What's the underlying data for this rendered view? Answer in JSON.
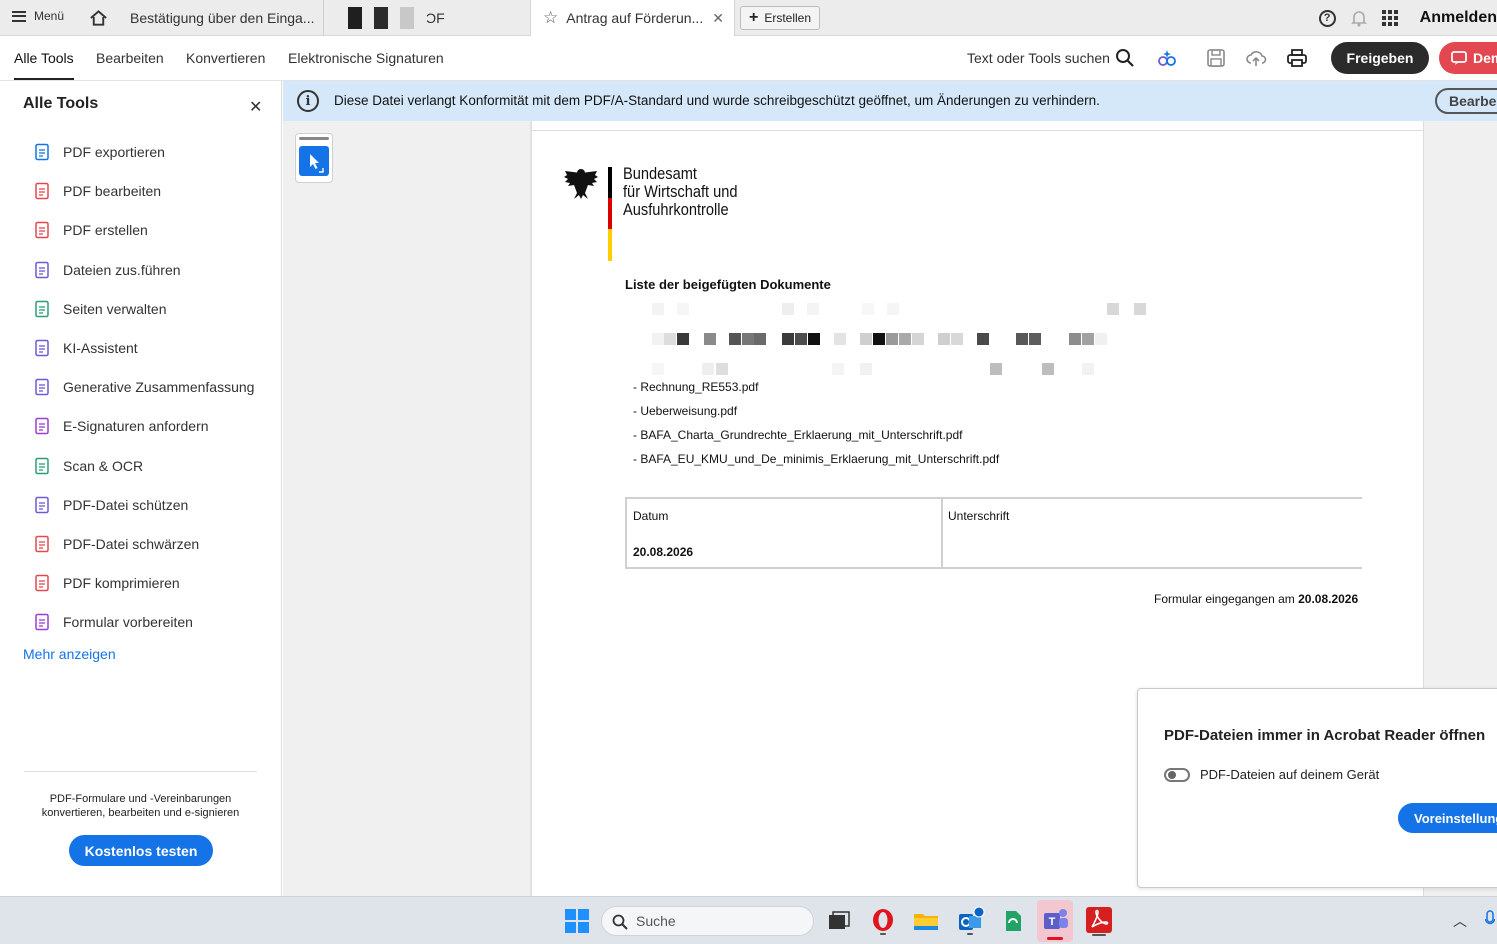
{
  "tabbar": {
    "menu_label": "Menü",
    "tab1_title": "Bestätigung über den Einga...",
    "tab2_suffix": "ϽF",
    "tab3_title": "Antrag auf Förderun...",
    "new_tab_label": "Erstellen",
    "signin_label": "Anmelden"
  },
  "toolbar": {
    "nav": [
      "Alle Tools",
      "Bearbeiten",
      "Konvertieren",
      "Elektronische Signaturen"
    ],
    "search_label": "Text oder Tools suchen",
    "share_label": "Freigeben",
    "demo_label": "Demo"
  },
  "leftpanel": {
    "title": "Alle Tools",
    "items": [
      {
        "label": "PDF exportieren",
        "icon": "export-pdf-icon",
        "color": "#1473e6"
      },
      {
        "label": "PDF bearbeiten",
        "icon": "edit-pdf-icon",
        "color": "#e34850"
      },
      {
        "label": "PDF erstellen",
        "icon": "create-pdf-icon",
        "color": "#e34850"
      },
      {
        "label": "Dateien zus.führen",
        "icon": "combine-files-icon",
        "color": "#6b5bd6"
      },
      {
        "label": "Seiten verwalten",
        "icon": "organize-pages-icon",
        "color": "#2d9d78"
      },
      {
        "label": "KI-Assistent",
        "icon": "ai-assistant-icon",
        "color": "#6b5bd6"
      },
      {
        "label": "Generative Zusammenfassung",
        "icon": "generative-summary-icon",
        "color": "#6b5bd6"
      },
      {
        "label": "E-Signaturen anfordern",
        "icon": "request-esign-icon",
        "color": "#9b3ed6"
      },
      {
        "label": "Scan & OCR",
        "icon": "scan-ocr-icon",
        "color": "#2d9d78"
      },
      {
        "label": "PDF-Datei schützen",
        "icon": "protect-pdf-icon",
        "color": "#6b5bd6"
      },
      {
        "label": "PDF-Datei schwärzen",
        "icon": "redact-pdf-icon",
        "color": "#e34850"
      },
      {
        "label": "PDF komprimieren",
        "icon": "compress-pdf-icon",
        "color": "#e34850"
      },
      {
        "label": "Formular vorbereiten",
        "icon": "prepare-form-icon",
        "color": "#9b3ed6"
      }
    ],
    "more_label": "Mehr anzeigen",
    "promo_text": "PDF-Formulare und -Vereinbarungen konvertieren, bearbeiten und e-signieren",
    "try_label": "Kostenlos testen"
  },
  "banner": {
    "message": "Diese Datei verlangt Konformität mit dem PDF/A-Standard und wurde schreibgeschützt geöffnet, um Änderungen zu verhindern.",
    "edit_label": "Bearbeiten"
  },
  "document": {
    "agency_line1": "Bundesamt",
    "agency_line2": "für Wirtschaft und",
    "agency_line3": "Ausfuhrkontrolle",
    "heading": "Liste der beigefügten Dokumente",
    "attachments": [
      "- Rechnung_RE553.pdf",
      "- Ueberweisung.pdf",
      "- BAFA_Charta_Grundrechte_Erklaerung_mit_Unterschrift.pdf",
      "- BAFA_EU_KMU_und_De_minimis_Erklaerung_mit_Unterschrift.pdf"
    ],
    "date_label": "Datum",
    "date_value": "20.08.2026",
    "signature_label": "Unterschrift",
    "received_prefix": "Formular eingegangen am",
    "received_date": "20.08.2026"
  },
  "popup": {
    "title": "PDF-Dateien immer in Acrobat Reader öffnen",
    "toggle_label": "PDF-Dateien auf deinem Gerät",
    "button_label": "Voreinstellungen"
  },
  "taskbar": {
    "search_placeholder": "Suche"
  }
}
